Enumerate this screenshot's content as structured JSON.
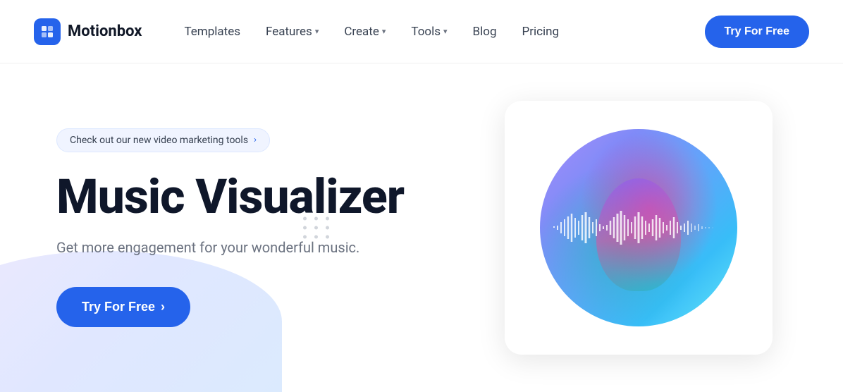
{
  "navbar": {
    "logo_text": "Motionbox",
    "logo_icon": "M",
    "links": [
      {
        "label": "Templates",
        "has_dropdown": false
      },
      {
        "label": "Features",
        "has_dropdown": true
      },
      {
        "label": "Create",
        "has_dropdown": true
      },
      {
        "label": "Tools",
        "has_dropdown": true
      },
      {
        "label": "Blog",
        "has_dropdown": false
      },
      {
        "label": "Pricing",
        "has_dropdown": false
      }
    ],
    "cta_label": "Try For Free"
  },
  "hero": {
    "badge_text": "Check out our new video marketing tools",
    "badge_arrow": "›",
    "title": "Music Visualizer",
    "subtitle": "Get more engagement for your wonderful music.",
    "cta_label": "Try For Free",
    "cta_arrow": "›"
  },
  "colors": {
    "accent": "#2563eb",
    "title_dark": "#0f172a",
    "text_gray": "#6b7280"
  }
}
